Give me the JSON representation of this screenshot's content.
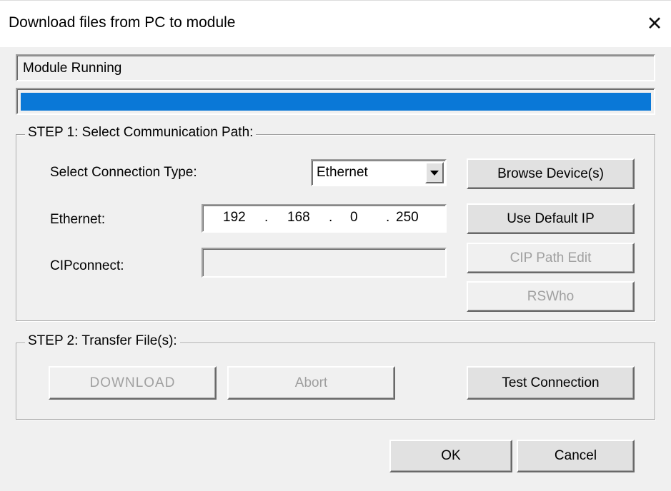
{
  "window": {
    "title": "Download files from PC to module",
    "close_glyph": "✕"
  },
  "status": {
    "text": "Module Running",
    "progress_fraction": 1.0,
    "progress_color": "#0a78d7"
  },
  "step1": {
    "title": "STEP 1: Select Communication Path:",
    "connection_type_label": "Select Connection Type:",
    "connection_type_value": "Ethernet",
    "browse_button": "Browse Device(s)",
    "ethernet_label": "Ethernet:",
    "ip": {
      "octet1": "192",
      "octet2": "168",
      "octet3": "0",
      "octet4": "250",
      "separator": "."
    },
    "default_ip_button": "Use Default IP",
    "cipconnect_label": "CIPconnect:",
    "cipconnect_value": "",
    "cip_path_edit_button": "CIP Path Edit",
    "rswho_button": "RSWho"
  },
  "step2": {
    "title": "STEP 2: Transfer File(s):",
    "download_button": "DOWNLOAD",
    "abort_button": "Abort",
    "test_connection_button": "Test Connection"
  },
  "footer": {
    "ok_button": "OK",
    "cancel_button": "Cancel"
  },
  "icons": {
    "close": "close-icon",
    "dropdown": "chevron-down-icon"
  }
}
